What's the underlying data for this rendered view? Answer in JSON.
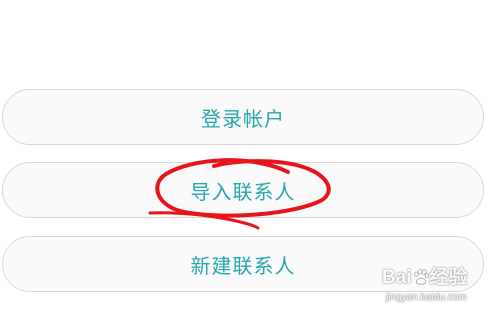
{
  "buttons": {
    "login_label": "登录帐户",
    "import_label": "导入联系人",
    "new_label": "新建联系人"
  },
  "colors": {
    "button_text": "#29a6ad",
    "button_border": "#d8d8d8",
    "annotation": "#e8141c"
  },
  "watermark": {
    "brand": "Bai经验",
    "url": "jingyan.baidu.com"
  }
}
